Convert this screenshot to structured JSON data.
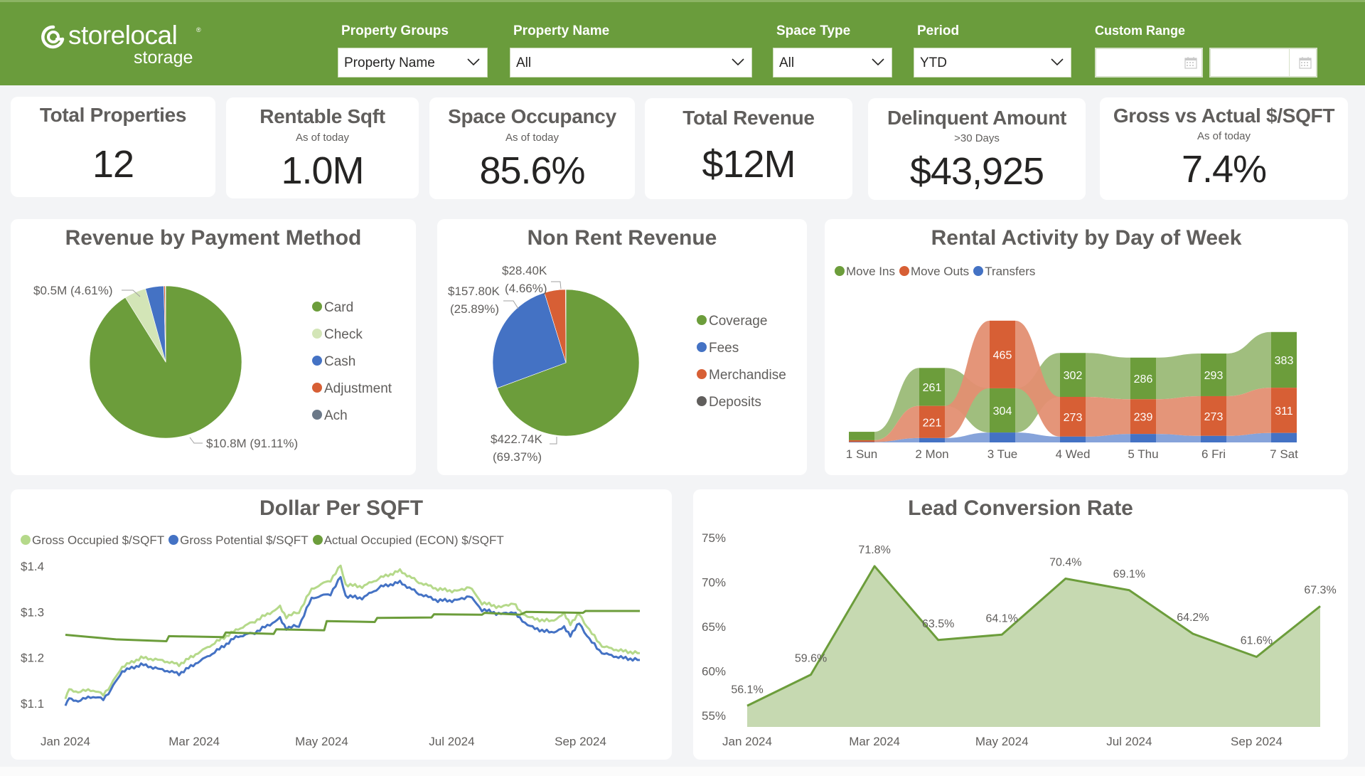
{
  "header": {
    "logo": {
      "brand": "storelocal",
      "sub": "storage",
      "reg": "®"
    },
    "filters": [
      {
        "label": "Property Groups",
        "value": "Property Name"
      },
      {
        "label": "Property Name",
        "value": "All"
      },
      {
        "label": "Space Type",
        "value": "All"
      },
      {
        "label": "Period",
        "value": "YTD"
      }
    ],
    "custom_range": {
      "label": "Custom Range",
      "start": "",
      "end": ""
    }
  },
  "kpis": [
    {
      "title": "Total Properties",
      "subtitle": "",
      "value": "12"
    },
    {
      "title": "Rentable Sqft",
      "subtitle": "As of today",
      "value": "1.0M"
    },
    {
      "title": "Space Occupancy",
      "subtitle": "As of today",
      "value": "85.6%"
    },
    {
      "title": "Total Revenue",
      "subtitle": "",
      "value": "$12M"
    },
    {
      "title": "Delinquent Amount",
      "subtitle": ">30 Days",
      "value": "$43,925"
    },
    {
      "title": "Gross vs Actual $/SQFT",
      "subtitle": "As of today",
      "value": "7.4%"
    }
  ],
  "colors": {
    "brand_green": "#6a9c3c",
    "green": "#6c9d3b",
    "light_green": "#d3e5b7",
    "blue": "#4472c4",
    "orange": "#d75f35",
    "slate": "#6b7888",
    "dark_gray": "#605e5c",
    "line_light_green": "#b5d98a"
  },
  "chart_data": [
    {
      "id": "payment",
      "type": "pie",
      "title": "Revenue by Payment Method",
      "legend_position": "right",
      "slices": [
        {
          "name": "Card",
          "percent": 91.11,
          "label": "$10.8M (91.11%)",
          "color": "#6c9d3b"
        },
        {
          "name": "Check",
          "percent": 4.61,
          "label": "$0.5M (4.61%)",
          "color": "#d3e5b7"
        },
        {
          "name": "Cash",
          "percent": 3.9,
          "label": "",
          "color": "#4472c4"
        },
        {
          "name": "Adjustment",
          "percent": 0.3,
          "label": "",
          "color": "#d75f35"
        },
        {
          "name": "Ach",
          "percent": 0.08,
          "label": "",
          "color": "#6b7888"
        }
      ]
    },
    {
      "id": "nonrent",
      "type": "pie",
      "title": "Non Rent Revenue",
      "legend_position": "right",
      "slices": [
        {
          "name": "Coverage",
          "percent": 69.37,
          "label": "$422.74K (69.37%)",
          "label_lines": [
            "$422.74K",
            "(69.37%)"
          ],
          "color": "#6c9d3b"
        },
        {
          "name": "Fees",
          "percent": 25.89,
          "label": "$157.80K (25.89%)",
          "label_lines": [
            "$157.80K",
            "(25.89%)"
          ],
          "color": "#4472c4"
        },
        {
          "name": "Merchandise",
          "percent": 4.66,
          "label": "$28.40K (4.66%)",
          "label_lines": [
            "$28.40K",
            "(4.66%)"
          ],
          "color": "#d75f35"
        },
        {
          "name": "Deposits",
          "percent": 0.08,
          "label": "",
          "color": "#605e5c"
        }
      ]
    },
    {
      "id": "activity",
      "type": "ribbon",
      "title": "Rental Activity by Day of Week",
      "legend_position": "top-left",
      "categories": [
        "1 Sun",
        "2 Mon",
        "3 Tue",
        "4 Wed",
        "5 Thu",
        "6 Fri",
        "7 Sat"
      ],
      "series": [
        {
          "name": "Move Ins",
          "color": "#6c9d3b",
          "values": [
            58,
            261,
            304,
            302,
            286,
            293,
            383
          ]
        },
        {
          "name": "Move Outs",
          "color": "#d75f35",
          "values": [
            12,
            221,
            465,
            273,
            239,
            273,
            311
          ]
        },
        {
          "name": "Transfers",
          "color": "#4472c4",
          "values": [
            3,
            30,
            68,
            40,
            58,
            45,
            65
          ]
        }
      ],
      "labeled_min": 200
    },
    {
      "id": "dpsf",
      "type": "line",
      "title": "Dollar Per SQFT",
      "legend_position": "top-left",
      "x_ticks": [
        "Jan 2024",
        "Mar 2024",
        "May 2024",
        "Jul 2024",
        "Sep 2024"
      ],
      "x_range": [
        "2024-01-01",
        "2024-10-13"
      ],
      "y_ticks": [
        "$1.1",
        "$1.2",
        "$1.3",
        "$1.4"
      ],
      "ylim": [
        1.08,
        1.41
      ],
      "series": [
        {
          "name": "Gross Occupied $/SQFT",
          "color": "#b5d98a",
          "points": [
            [
              0,
              1.11
            ],
            [
              3,
              1.13
            ],
            [
              10,
              1.125
            ],
            [
              20,
              1.13
            ],
            [
              30,
              1.12
            ],
            [
              36,
              1.14
            ],
            [
              45,
              1.18
            ],
            [
              60,
              1.2
            ],
            [
              75,
              1.195
            ],
            [
              90,
              1.185
            ],
            [
              105,
              1.21
            ],
            [
              120,
              1.235
            ],
            [
              135,
              1.26
            ],
            [
              150,
              1.28
            ],
            [
              170,
              1.31
            ],
            [
              175,
              1.29
            ],
            [
              185,
              1.3
            ],
            [
              195,
              1.35
            ],
            [
              210,
              1.37
            ],
            [
              218,
              1.4
            ],
            [
              222,
              1.36
            ],
            [
              235,
              1.355
            ],
            [
              250,
              1.375
            ],
            [
              265,
              1.39
            ],
            [
              280,
              1.365
            ],
            [
              295,
              1.35
            ],
            [
              310,
              1.345
            ],
            [
              320,
              1.355
            ],
            [
              330,
              1.32
            ],
            [
              345,
              1.31
            ],
            [
              355,
              1.32
            ],
            [
              360,
              1.3
            ],
            [
              370,
              1.285
            ],
            [
              385,
              1.28
            ],
            [
              395,
              1.295
            ],
            [
              400,
              1.275
            ],
            [
              407,
              1.295
            ],
            [
              415,
              1.26
            ],
            [
              425,
              1.225
            ],
            [
              440,
              1.215
            ],
            [
              455,
              1.21
            ]
          ]
        },
        {
          "name": "Gross Potential $/SQFT",
          "color": "#4472c4",
          "points": [
            [
              0,
              1.095
            ],
            [
              3,
              1.11
            ],
            [
              10,
              1.105
            ],
            [
              20,
              1.115
            ],
            [
              30,
              1.11
            ],
            [
              36,
              1.13
            ],
            [
              45,
              1.17
            ],
            [
              60,
              1.185
            ],
            [
              75,
              1.175
            ],
            [
              90,
              1.165
            ],
            [
              105,
              1.19
            ],
            [
              120,
              1.215
            ],
            [
              135,
              1.245
            ],
            [
              150,
              1.255
            ],
            [
              170,
              1.285
            ],
            [
              175,
              1.265
            ],
            [
              185,
              1.27
            ],
            [
              195,
              1.33
            ],
            [
              210,
              1.34
            ],
            [
              218,
              1.375
            ],
            [
              222,
              1.335
            ],
            [
              235,
              1.33
            ],
            [
              250,
              1.355
            ],
            [
              265,
              1.365
            ],
            [
              280,
              1.34
            ],
            [
              295,
              1.325
            ],
            [
              310,
              1.325
            ],
            [
              320,
              1.335
            ],
            [
              330,
              1.305
            ],
            [
              345,
              1.295
            ],
            [
              355,
              1.3
            ],
            [
              360,
              1.285
            ],
            [
              370,
              1.265
            ],
            [
              385,
              1.255
            ],
            [
              395,
              1.265
            ],
            [
              400,
              1.25
            ],
            [
              407,
              1.275
            ],
            [
              415,
              1.24
            ],
            [
              425,
              1.21
            ],
            [
              440,
              1.2
            ],
            [
              455,
              1.195
            ]
          ]
        },
        {
          "name": "Actual Occupied (ECON) $/SQFT",
          "color": "#6c9d3b",
          "points": [
            [
              0,
              1.25
            ],
            [
              40,
              1.24
            ],
            [
              80,
              1.236
            ],
            [
              82,
              1.247
            ],
            [
              125,
              1.245
            ],
            [
              127,
              1.255
            ],
            [
              165,
              1.252
            ],
            [
              167,
              1.262
            ],
            [
              205,
              1.26
            ],
            [
              207,
              1.28
            ],
            [
              245,
              1.278
            ],
            [
              247,
              1.287
            ],
            [
              290,
              1.288
            ],
            [
              292,
              1.295
            ],
            [
              330,
              1.294
            ],
            [
              332,
              1.298
            ],
            [
              360,
              1.294
            ],
            [
              365,
              1.3
            ],
            [
              410,
              1.298
            ],
            [
              412,
              1.302
            ],
            [
              455,
              1.302
            ]
          ]
        }
      ]
    },
    {
      "id": "lcr",
      "type": "area",
      "title": "Lead Conversion Rate",
      "legend_position": "none",
      "x": [
        "Jan 2024",
        "Feb 2024",
        "Mar 2024",
        "Apr 2024",
        "May 2024",
        "Jun 2024",
        "Jul 2024",
        "Aug 2024",
        "Sep 2024",
        "Oct 2024"
      ],
      "x_ticks": [
        "Jan 2024",
        "Mar 2024",
        "May 2024",
        "Jul 2024",
        "Sep 2024"
      ],
      "values": [
        56.1,
        59.6,
        71.8,
        63.5,
        64.1,
        70.4,
        69.1,
        64.2,
        61.6,
        67.3
      ],
      "data_labels": [
        "56.1%",
        "59.6%",
        "71.8%",
        "63.5%",
        "64.1%",
        "70.4%",
        "69.1%",
        "64.2%",
        "61.6%",
        "67.3%"
      ],
      "y_ticks": [
        "55%",
        "60%",
        "65%",
        "70%",
        "75%"
      ],
      "ylim": [
        53,
        75
      ],
      "color": "#6c9d3b",
      "fill": "#c6d9b1"
    }
  ]
}
